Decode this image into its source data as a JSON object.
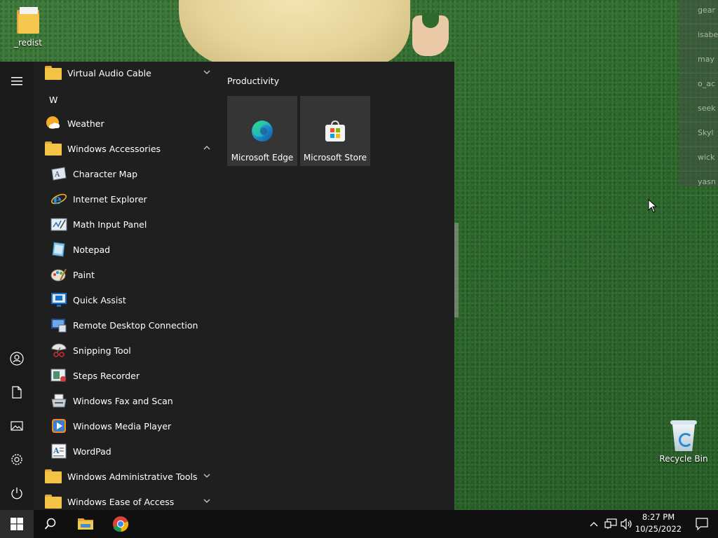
{
  "desktop": {
    "icons": [
      {
        "label": "_redist",
        "icon": "folder-icon"
      },
      {
        "label": "Recycle Bin",
        "icon": "recycle-bin-icon"
      }
    ],
    "side_list": [
      "gear",
      "isabe",
      "may",
      "o_ac",
      "seek",
      "Skyl",
      "wick",
      "yasn"
    ]
  },
  "start_menu": {
    "app_list": [
      {
        "type": "folder",
        "label": "Virtual Audio Cable",
        "icon": "folder-icon",
        "expanded": false
      },
      {
        "type": "header",
        "label": "W"
      },
      {
        "type": "app",
        "label": "Weather",
        "icon": "weather-icon"
      },
      {
        "type": "folder",
        "label": "Windows Accessories",
        "icon": "folder-icon",
        "expanded": true
      },
      {
        "type": "sub",
        "label": "Character Map",
        "icon": "character-map-icon"
      },
      {
        "type": "sub",
        "label": "Internet Explorer",
        "icon": "internet-explorer-icon"
      },
      {
        "type": "sub",
        "label": "Math Input Panel",
        "icon": "math-input-panel-icon"
      },
      {
        "type": "sub",
        "label": "Notepad",
        "icon": "notepad-icon"
      },
      {
        "type": "sub",
        "label": "Paint",
        "icon": "paint-icon"
      },
      {
        "type": "sub",
        "label": "Quick Assist",
        "icon": "quick-assist-icon"
      },
      {
        "type": "sub",
        "label": "Remote Desktop Connection",
        "icon": "remote-desktop-icon"
      },
      {
        "type": "sub",
        "label": "Snipping Tool",
        "icon": "snipping-tool-icon"
      },
      {
        "type": "sub",
        "label": "Steps Recorder",
        "icon": "steps-recorder-icon"
      },
      {
        "type": "sub",
        "label": "Windows Fax and Scan",
        "icon": "fax-scan-icon"
      },
      {
        "type": "sub",
        "label": "Windows Media Player",
        "icon": "media-player-icon"
      },
      {
        "type": "sub",
        "label": "WordPad",
        "icon": "wordpad-icon"
      },
      {
        "type": "folder",
        "label": "Windows Administrative Tools",
        "icon": "folder-icon",
        "expanded": false
      },
      {
        "type": "folder",
        "label": "Windows Ease of Access",
        "icon": "folder-icon",
        "expanded": false
      }
    ],
    "tile_group": {
      "title": "Productivity",
      "tiles": [
        {
          "label": "Microsoft Edge",
          "icon": "edge-icon"
        },
        {
          "label": "Microsoft Store",
          "icon": "store-icon"
        }
      ]
    },
    "rail": [
      "hamburger-icon",
      "user-icon",
      "documents-icon",
      "pictures-icon",
      "settings-icon",
      "power-icon"
    ]
  },
  "taskbar": {
    "time": "8:27 PM",
    "date": "10/25/2022",
    "pinned": [
      "start-icon",
      "search-icon",
      "file-explorer-icon",
      "chrome-icon"
    ],
    "tray": [
      "chevron-up-icon",
      "network-icon",
      "volume-icon",
      "notifications-icon"
    ]
  },
  "colors": {
    "menu_bg": "#1f1f1f",
    "tile_bg": "#353535",
    "taskbar_bg": "#101010",
    "folder_yellow": "#f4c245"
  }
}
